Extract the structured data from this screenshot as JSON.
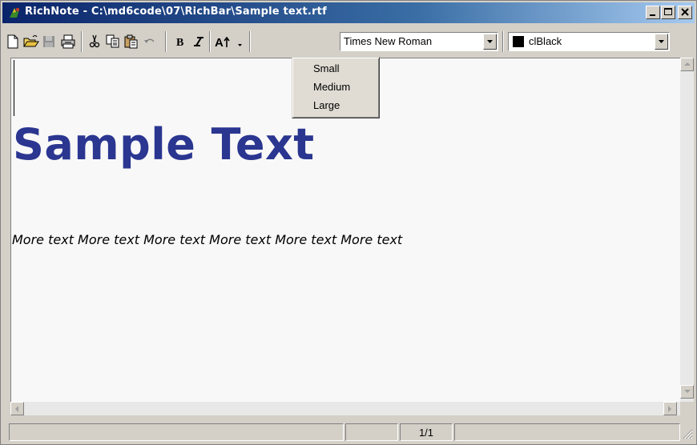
{
  "window": {
    "title": "RichNote - C:\\md6code\\07\\RichBar\\Sample text.rtf",
    "icon": "richnote-app-icon"
  },
  "toolbar": {
    "buttons": [
      "new-icon",
      "open-icon",
      "save-icon",
      "print-icon",
      "cut-icon",
      "copy-icon",
      "paste-icon",
      "undo-icon",
      "bold-icon",
      "italic-icon",
      "font-size-icon"
    ],
    "font_name": "Times New Roman",
    "color_name": "clBlack",
    "color_swatch": "#000000"
  },
  "font_size_menu": {
    "items": [
      {
        "label": "Small"
      },
      {
        "label": "Medium"
      },
      {
        "label": "Large"
      }
    ]
  },
  "document": {
    "heading": "Sample Text",
    "heading_color": "#2a3690",
    "body": "More text More text More text More text More text More text"
  },
  "statusbar": {
    "page": "1/1"
  }
}
